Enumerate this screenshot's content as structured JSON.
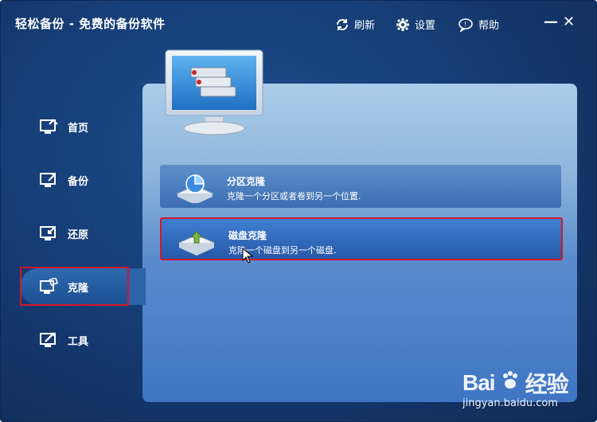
{
  "title": "轻松备份 - 免费的备份软件",
  "toolbar": {
    "refresh_label": "刷新",
    "settings_label": "设置",
    "help_label": "帮助",
    "minimize": "—",
    "close": "✕"
  },
  "sidebar": {
    "items": [
      {
        "label": "首页",
        "icon": "home-monitor-icon"
      },
      {
        "label": "备份",
        "icon": "backup-monitor-icon"
      },
      {
        "label": "还原",
        "icon": "restore-monitor-icon"
      },
      {
        "label": "克隆",
        "icon": "clone-monitor-icon",
        "active": true
      },
      {
        "label": "工具",
        "icon": "tools-monitor-icon"
      }
    ]
  },
  "options": [
    {
      "title": "分区克隆",
      "desc": "克隆一个分区或者卷到另一个位置.",
      "icon": "partition-pie-icon"
    },
    {
      "title": "磁盘克隆",
      "desc": "克隆一个磁盘到另一个磁盘.",
      "icon": "disk-clone-icon",
      "selected": true
    }
  ],
  "watermark": {
    "brand": "Bai",
    "brand2": "经验",
    "url": "jingyan.baidu.com"
  },
  "colors": {
    "highlight_border": "#d3182a",
    "panel_top": "#a9cde9",
    "window_bg": "#173f78"
  }
}
